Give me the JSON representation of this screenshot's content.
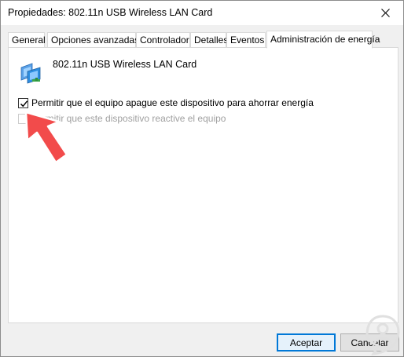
{
  "window": {
    "title": "Propiedades: 802.11n USB Wireless LAN Card",
    "close_icon": "close-icon"
  },
  "tabs": [
    {
      "label": "General",
      "active": false
    },
    {
      "label": "Opciones avanzadas",
      "active": false
    },
    {
      "label": "Controlador",
      "active": false
    },
    {
      "label": "Detalles",
      "active": false
    },
    {
      "label": "Eventos",
      "active": false
    },
    {
      "label": "Administración de energía",
      "active": true
    }
  ],
  "device": {
    "icon": "network-adapter-icon",
    "name": "802.11n USB Wireless LAN Card"
  },
  "options": [
    {
      "label": "Permitir que el equipo apague este dispositivo para ahorrar energía",
      "checked": true,
      "enabled": true
    },
    {
      "label": "Permitir que este dispositivo reactive el equipo",
      "checked": false,
      "enabled": false
    }
  ],
  "buttons": {
    "ok": "Aceptar",
    "cancel": "Cancelar"
  },
  "colors": {
    "accent": "#0078d7",
    "arrow": "#f24b4b",
    "watermark": "#e0e0e0"
  }
}
